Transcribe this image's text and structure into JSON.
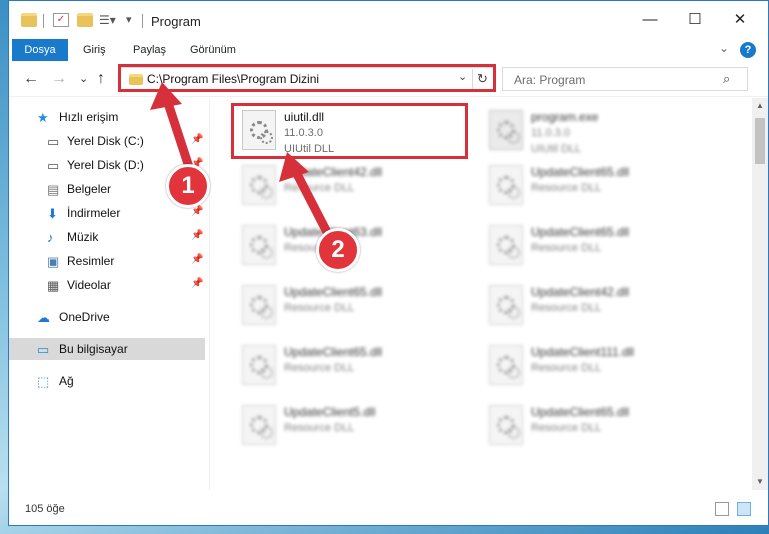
{
  "titlebar": {
    "title": "Program",
    "minimize_glyph": "—",
    "maximize_glyph": "☐",
    "close_glyph": "✕"
  },
  "ribbon": {
    "tabs": [
      "Dosya",
      "Giriş",
      "Paylaş",
      "Görünüm"
    ],
    "help_glyph": "?",
    "collapse_glyph": "⌄"
  },
  "navigation": {
    "back_glyph": "←",
    "forward_glyph": "→",
    "recent_glyph": "⌄",
    "up_glyph": "↑",
    "address": "C:\\Program Files\\Program Dizini",
    "address_dropdown_glyph": "⌄",
    "refresh_glyph": "↻",
    "search_placeholder": "Ara: Program",
    "search_glyph": "⌕"
  },
  "sidebar": {
    "items": [
      {
        "label": "Hızlı erişim",
        "icon": "star-icon",
        "pinned": false
      },
      {
        "label": "Yerel Disk (C:)",
        "icon": "drive-icon",
        "pinned": true
      },
      {
        "label": "Yerel Disk (D:)",
        "icon": "drive-icon",
        "pinned": true
      },
      {
        "label": "Belgeler",
        "icon": "documents-icon",
        "pinned": true
      },
      {
        "label": "İndirmeler",
        "icon": "download-icon",
        "pinned": true
      },
      {
        "label": "Müzik",
        "icon": "music-icon",
        "pinned": true
      },
      {
        "label": "Resimler",
        "icon": "pictures-icon",
        "pinned": true
      },
      {
        "label": "Videolar",
        "icon": "videos-icon",
        "pinned": true
      },
      {
        "label": "OneDrive",
        "icon": "cloud-icon",
        "pinned": false
      },
      {
        "label": "Bu bilgisayar",
        "icon": "computer-icon",
        "pinned": false,
        "selected": true
      },
      {
        "label": "Ağ",
        "icon": "network-icon",
        "pinned": false
      }
    ],
    "pin_glyph": "📌"
  },
  "files": [
    {
      "name": "uiutil.dll",
      "version": "11.0.3.0",
      "desc": "UIUtil DLL",
      "clear": true,
      "icon": "gear-file-icon"
    },
    {
      "name": "program.exe",
      "version": "11.0.3.0",
      "desc": "UIUtil DLL",
      "clear": false,
      "icon": "exe-file-icon"
    },
    {
      "name": "UpdateClient42.dll",
      "version": "",
      "desc": "Resource DLL",
      "clear": false,
      "icon": "gear-file-icon"
    },
    {
      "name": "UpdateClient65.dll",
      "version": "",
      "desc": "Resource DLL",
      "clear": false,
      "icon": "gear-file-icon"
    },
    {
      "name": "UpdateClient63.dll",
      "version": "",
      "desc": "Resource DLL",
      "clear": false,
      "icon": "gear-file-icon"
    },
    {
      "name": "UpdateClient65.dll",
      "version": "",
      "desc": "Resource DLL",
      "clear": false,
      "icon": "gear-file-icon"
    },
    {
      "name": "UpdateClient65.dll",
      "version": "",
      "desc": "Resource DLL",
      "clear": false,
      "icon": "gear-file-icon"
    },
    {
      "name": "UpdateClient42.dll",
      "version": "",
      "desc": "Resource DLL",
      "clear": false,
      "icon": "gear-file-icon"
    },
    {
      "name": "UpdateClient65.dll",
      "version": "",
      "desc": "Resource DLL",
      "clear": false,
      "icon": "gear-file-icon"
    },
    {
      "name": "UpdateClient111.dll",
      "version": "",
      "desc": "Resource DLL",
      "clear": false,
      "icon": "gear-file-icon"
    },
    {
      "name": "UpdateClient5.dll",
      "version": "",
      "desc": "Resource DLL",
      "clear": false,
      "icon": "gear-file-icon"
    },
    {
      "name": "UpdateClient65.dll",
      "version": "",
      "desc": "Resource DLL",
      "clear": false,
      "icon": "gear-file-icon"
    }
  ],
  "status": {
    "item_count": "105 öğe"
  },
  "annotations": {
    "badge1": "1",
    "badge2": "2",
    "color": "#d6313b"
  }
}
